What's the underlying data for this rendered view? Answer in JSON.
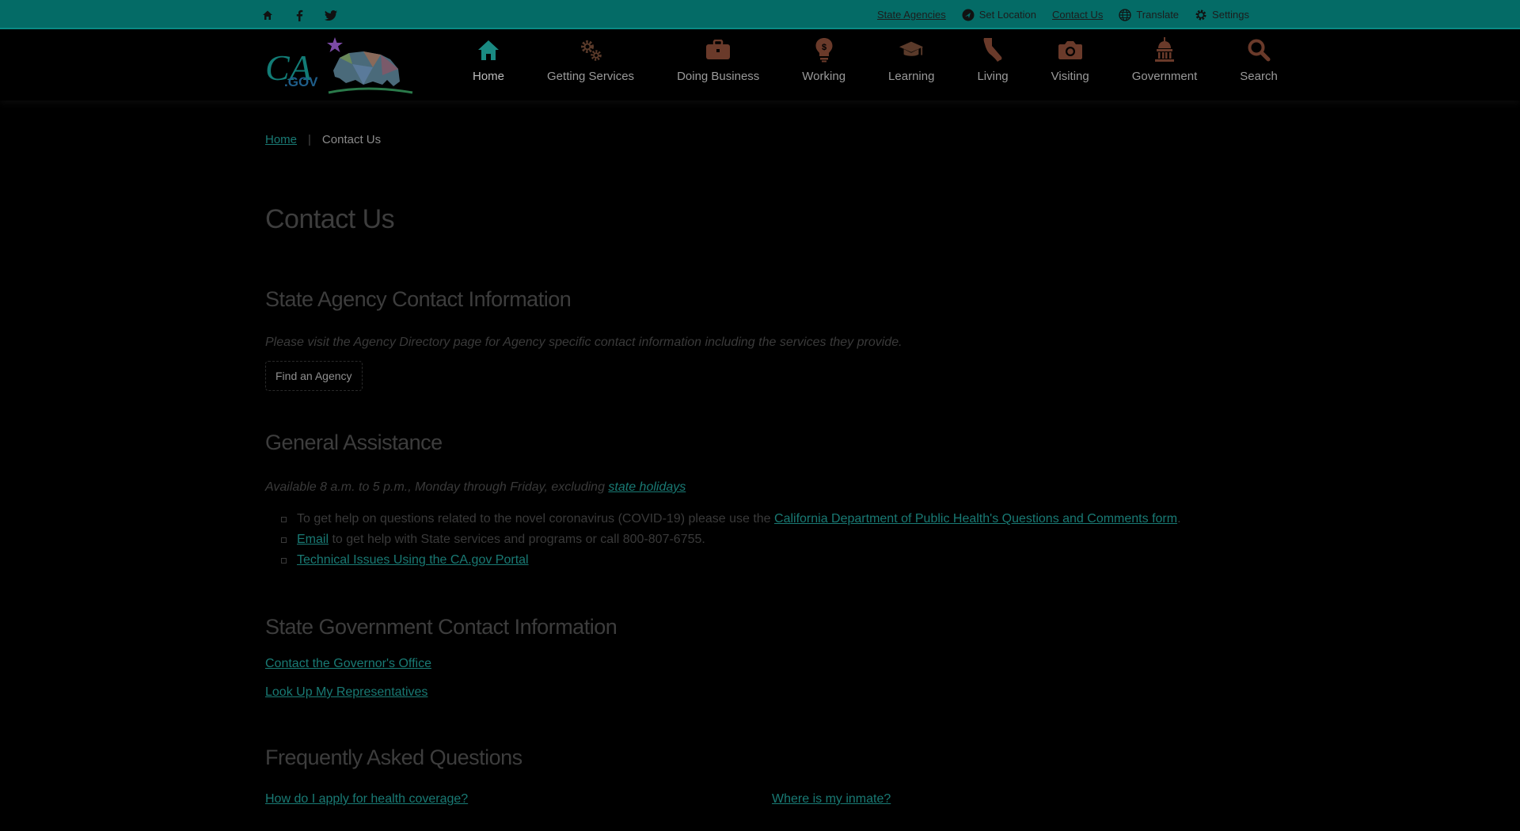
{
  "colors": {
    "utility_bg": "#046b66",
    "link": "#197a74",
    "page_bg": "#000000"
  },
  "utility": {
    "social": [
      "home-icon",
      "facebook-icon",
      "twitter-icon"
    ],
    "links": [
      {
        "label": "State Agencies",
        "icon": ""
      },
      {
        "label": "Set Location",
        "icon": "location-icon"
      },
      {
        "label": "Contact Us",
        "icon": ""
      },
      {
        "label": "Translate",
        "icon": "globe-icon"
      },
      {
        "label": "Settings",
        "icon": "gear-icon"
      }
    ]
  },
  "brand": {
    "logo_text": "CA.GOV"
  },
  "nav": [
    {
      "label": "Home",
      "icon": "home-icon"
    },
    {
      "label": "Getting Services",
      "icon": "gears-icon"
    },
    {
      "label": "Doing Business",
      "icon": "briefcase-icon"
    },
    {
      "label": "Working",
      "icon": "lightbulb-icon"
    },
    {
      "label": "Learning",
      "icon": "graduation-cap-icon"
    },
    {
      "label": "Living",
      "icon": "california-icon"
    },
    {
      "label": "Visiting",
      "icon": "camera-icon"
    },
    {
      "label": "Government",
      "icon": "capitol-icon"
    },
    {
      "label": "Search",
      "icon": "search-icon"
    }
  ],
  "breadcrumb": {
    "home": "Home",
    "current": "Contact Us"
  },
  "page": {
    "title": "Contact Us"
  },
  "agency": {
    "heading": "State Agency Contact Information",
    "text": "Please visit the Agency Directory page for Agency specific contact information including the services they provide.",
    "button": "Find an Agency"
  },
  "general": {
    "heading": "General Assistance",
    "hours": "Available 8 a.m. to 5 p.m., Monday through Friday, excluding ",
    "hours_link": "state holidays",
    "items": [
      {
        "pre": "To get help on questions related to the novel coronavirus (COVID-19) please use the ",
        "link": "California Department of Public Health's Questions and Comments form",
        "post": "."
      },
      {
        "pre": "",
        "link": "Email",
        "post": " to get help with State services and programs or call 800-807-6755."
      },
      {
        "pre": "",
        "link": "Technical Issues Using the CA.gov Portal",
        "post": ""
      }
    ]
  },
  "government": {
    "heading": "State Government Contact Information",
    "links": [
      "Contact the Governor's Office",
      "Look Up My Representatives"
    ]
  },
  "faq": {
    "heading": "Frequently Asked Questions",
    "links": [
      "How do I apply for health coverage?",
      "Where is my inmate?"
    ]
  }
}
